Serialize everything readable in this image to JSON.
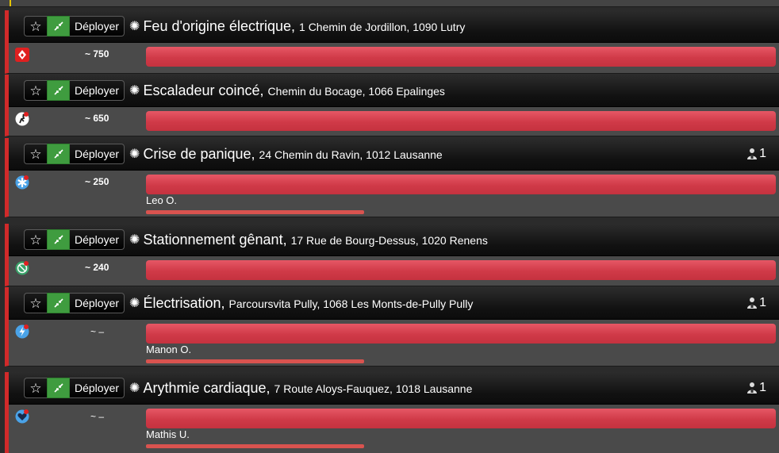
{
  "missions": [
    {
      "title": "Feu d'origine électrique,",
      "address": "1 Chemin de Jordillon, 1090 Lutry",
      "credits": "~ 750",
      "deploy_label": "Déployer",
      "icon": "fire-icon",
      "icon_color": "#e02020",
      "persons": "",
      "unit": ""
    },
    {
      "title": "Escaladeur coincé,",
      "address": "Chemin du Bocage, 1066 Epalinges",
      "credits": "~ 650",
      "deploy_label": "Déployer",
      "icon": "climber-icon",
      "icon_color": "#ffffff",
      "persons": "",
      "unit": ""
    },
    {
      "title": "Crise de panique,",
      "address": "24 Chemin du Ravin, 1012 Lausanne",
      "credits": "~ 250",
      "deploy_label": "Déployer",
      "icon": "medical-star-icon",
      "icon_color": "#4aa3e8",
      "persons": "1",
      "unit": "Leo O."
    },
    {
      "title": "Stationnement gênant,",
      "address": "17 Rue de Bourg-Dessus, 1020 Renens",
      "credits": "~ 240",
      "deploy_label": "Déployer",
      "icon": "police-icon",
      "icon_color": "#3aa36a",
      "persons": "",
      "unit": ""
    },
    {
      "title": "Électrisation,",
      "address": "Parcoursvita Pully, 1068 Les Monts-de-Pully Pully",
      "credits": "~ –",
      "deploy_label": "Déployer",
      "icon": "lightning-icon",
      "icon_color": "#4aa3e8",
      "persons": "1",
      "unit": "Manon O."
    },
    {
      "title": "Arythmie cardiaque,",
      "address": "7 Route Aloys-Fauquez, 1018 Lausanne",
      "credits": "~ –",
      "deploy_label": "Déployer",
      "icon": "heart-icon",
      "icon_color": "#4aa3e8",
      "persons": "1",
      "unit": "Mathis U."
    }
  ]
}
